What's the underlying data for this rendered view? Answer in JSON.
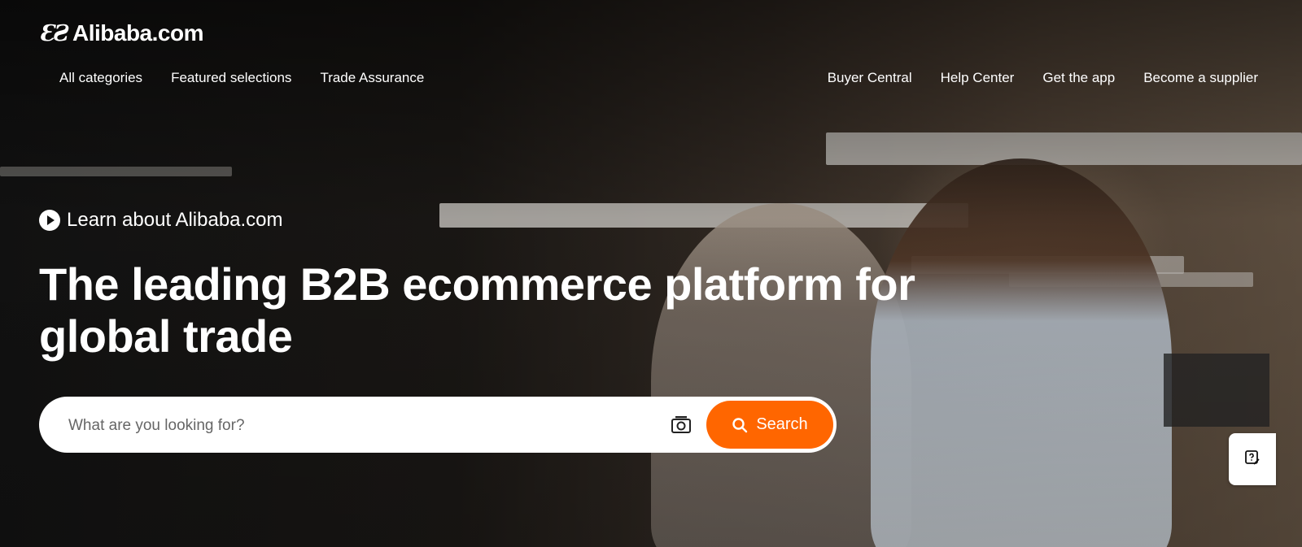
{
  "brand": {
    "name": "Alibaba.com",
    "logo_mark": "ƐƧ"
  },
  "nav": {
    "left": [
      "All categories",
      "Featured selections",
      "Trade Assurance"
    ],
    "right": [
      "Buyer Central",
      "Help Center",
      "Get the app",
      "Become a supplier"
    ]
  },
  "hero": {
    "learn_link": "Learn about Alibaba.com",
    "headline": "The leading B2B ecommerce platform for global trade"
  },
  "search": {
    "placeholder": "What are you looking for?",
    "button_label": "Search"
  },
  "colors": {
    "accent": "#ff6600",
    "text": "#ffffff"
  },
  "icons": [
    "play-icon",
    "camera-icon",
    "search-icon",
    "feedback-icon"
  ]
}
